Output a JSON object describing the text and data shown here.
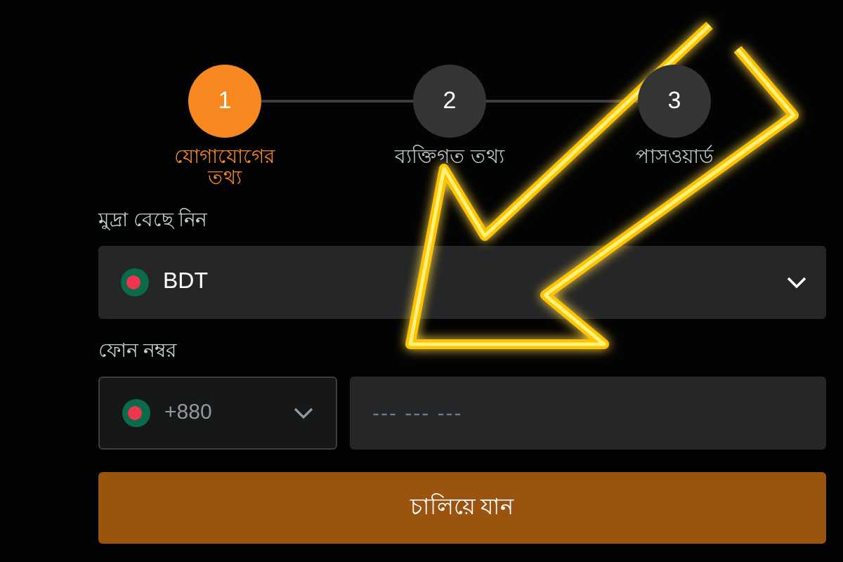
{
  "steps": [
    {
      "number": "1",
      "label": "যোগাযোগের তথ্য",
      "selected": true
    },
    {
      "number": "2",
      "label": "ব্যক্তিগত তথ্য",
      "selected": false
    },
    {
      "number": "3",
      "label": "পাসওয়ার্ড",
      "selected": false
    }
  ],
  "currency": {
    "label": "মুদ্রা বেছে নিন",
    "value": "BDT"
  },
  "phone": {
    "label": "ফোন নম্বর",
    "code": "+880",
    "placeholder": "--- --- ---"
  },
  "submit": "চালিয়ে যান"
}
